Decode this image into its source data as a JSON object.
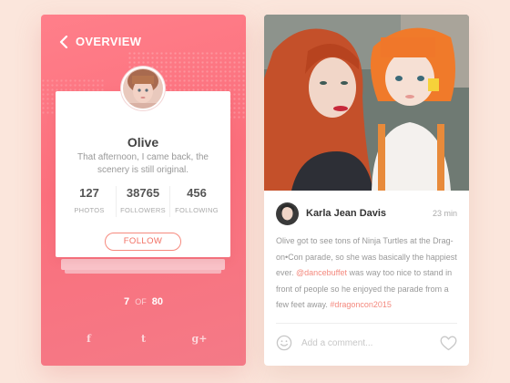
{
  "overview": {
    "title": "OVERVIEW",
    "profile": {
      "name": "Olive",
      "bio": "That afternoon, I came back, the scenery is still original.",
      "stats": [
        {
          "value": "127",
          "label": "PHOTOS"
        },
        {
          "value": "38765",
          "label": "FOLLOWERS"
        },
        {
          "value": "456",
          "label": "FOLLOWING"
        }
      ],
      "follow_label": "FOLLOW"
    },
    "pager": {
      "current": "7",
      "of": "OF",
      "total": "80"
    },
    "socials": [
      {
        "icon": "facebook-icon",
        "glyph": "f"
      },
      {
        "icon": "twitter-icon",
        "glyph": "t"
      },
      {
        "icon": "google-plus-icon",
        "glyph": "g+"
      }
    ],
    "colors": {
      "accent": "#fb6f7c",
      "follow": "#f26f62"
    }
  },
  "post": {
    "author": "Karla Jean Davis",
    "time": "23 min",
    "text_parts": {
      "p1": "Olive got to see tons of Ninja Turtles at the Drag-on•Con parade, so she was basically the happiest ever. ",
      "mention": "@dancebuffet",
      "p2": " was way too nice to stand in front of people so he enjoyed the parade from a few feet away. ",
      "hashtag": "#dragoncon2015"
    },
    "comment_placeholder": "Add a comment...",
    "colors": {
      "highlight": "#f4897e"
    }
  }
}
